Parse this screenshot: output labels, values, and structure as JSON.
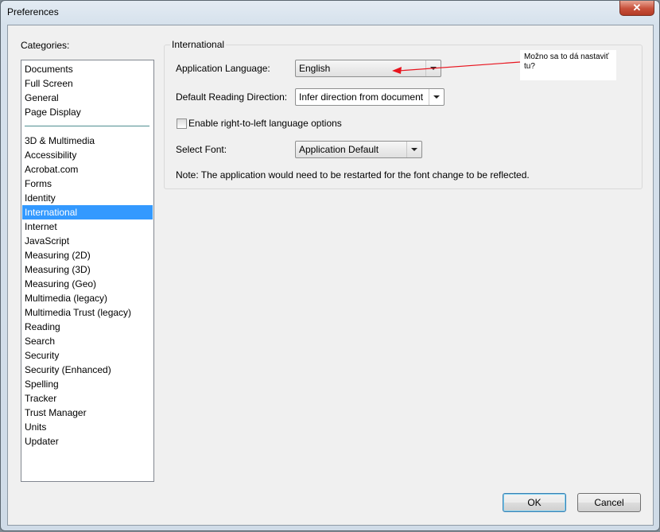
{
  "window": {
    "title": "Preferences",
    "close_glyph": "✕"
  },
  "categories": {
    "label": "Categories:",
    "top_items": [
      "Documents",
      "Full Screen",
      "General",
      "Page Display"
    ],
    "items": [
      "3D & Multimedia",
      "Accessibility",
      "Acrobat.com",
      "Forms",
      "Identity",
      "International",
      "Internet",
      "JavaScript",
      "Measuring (2D)",
      "Measuring (3D)",
      "Measuring (Geo)",
      "Multimedia (legacy)",
      "Multimedia Trust (legacy)",
      "Reading",
      "Search",
      "Security",
      "Security (Enhanced)",
      "Spelling",
      "Tracker",
      "Trust Manager",
      "Units",
      "Updater"
    ],
    "selected": "International"
  },
  "international": {
    "group_title": "International",
    "app_language_label": "Application Language:",
    "app_language_value": "English",
    "reading_direction_label": "Default Reading Direction:",
    "reading_direction_value": "Infer direction from document",
    "rtl_checkbox_label": "Enable right-to-left language options",
    "rtl_checked": false,
    "select_font_label": "Select Font:",
    "select_font_value": "Application Default",
    "note": "Note: The application would need to be restarted for the font change to be reflected."
  },
  "annotation": {
    "text": "Možno sa to dá nastaviť tu?",
    "arrow_color": "#e8141e"
  },
  "buttons": {
    "ok": "OK",
    "cancel": "Cancel"
  }
}
